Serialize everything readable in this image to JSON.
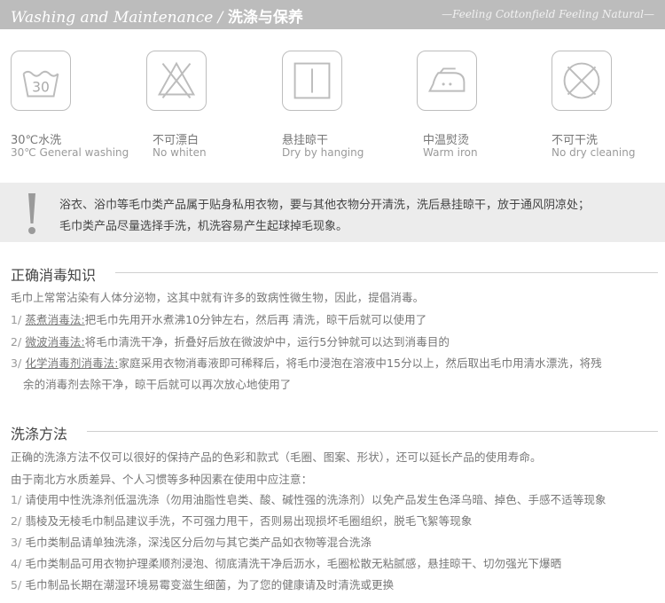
{
  "header": {
    "title_en": "Washing and Maintenance /",
    "title_cn": "洗涤与保养",
    "tagline": "—Feeling Cottonfield Feeling Natural—"
  },
  "care_icons": [
    {
      "icon": "wash-30-icon",
      "number": "30",
      "cn": "30℃水洗",
      "en": "30℃ General washing"
    },
    {
      "icon": "no-bleach-icon",
      "cn": "不可漂白",
      "en": "No whiten"
    },
    {
      "icon": "hang-dry-icon",
      "cn": "悬挂晾干",
      "en": "Dry by hanging"
    },
    {
      "icon": "warm-iron-icon",
      "cn": "中温熨烫",
      "en": "Warm iron"
    },
    {
      "icon": "no-dry-clean-icon",
      "cn": "不可干洗",
      "en": "No dry cleaning"
    }
  ],
  "notice": {
    "icon": "exclamation-icon",
    "line1": "浴衣、浴巾等毛巾类产品属于贴身私用衣物，要与其他衣物分开清洗，洗后悬挂晾干，放于通风阴凉处；",
    "line2": "毛巾类产品尽量选择手洗，机洗容易产生起球掉毛现象。"
  },
  "disinfection": {
    "title": "正确消毒知识",
    "intro": "毛巾上常常沾染有人体分泌物，这其中就有许多的致病性微生物，因此，提倡消毒。",
    "items": [
      {
        "num": "1/",
        "method": "蒸煮消毒法:",
        "text": "把毛巾先用开水煮沸10分钟左右，然后再 清洗，晾干后就可以使用了"
      },
      {
        "num": "2/",
        "method": "微波消毒法:",
        "text": "将毛巾清洗干净，折叠好后放在微波炉中，运行5分钟就可以达到消毒目的"
      },
      {
        "num": "3/",
        "method": "化学消毒剂消毒法:",
        "text": "家庭采用衣物消毒液即可稀释后，将毛巾浸泡在溶液中15分以上，然后取出毛巾用清水漂洗，将残",
        "text2": "余的消毒剂去除干净，晾干后就可以再次放心地使用了"
      }
    ]
  },
  "washing": {
    "title": "洗涤方法",
    "intro1": "正确的洗涤方法不仅可以很好的保持产品的色彩和款式（毛圈、图案、形状），还可以延长产品的使用寿命。",
    "intro2": "由于南北方水质差异、个人习惯等多种因素在使用中应注意：",
    "items": [
      {
        "num": "1/",
        "text": "请使用中性洗涤剂低温洗涤（勿用油脂性皂类、酸、碱性强的洗涤剂）以免产品发生色泽乌暗、掉色、手感不适等现象"
      },
      {
        "num": "2/",
        "text": "翡棱及无棱毛巾制品建议手洗，不可强力甩干，否则易出现损坏毛圈组织，脱毛飞絮等现象"
      },
      {
        "num": "3/",
        "text": "毛巾类制品请单独洗涤，深浅区分后勿与其它类产品如衣物等混合洗涤"
      },
      {
        "num": "4/",
        "text": "毛巾类制品可用衣物护理柔顺剂浸泡、彻底清洗干净后沥水，毛圈松散无粘腻感，悬挂晾干、切勿强光下爆晒"
      },
      {
        "num": "5/",
        "text": "毛巾制品长期在潮湿环境易霉变滋生细菌，为了您的健康请及时清洗或更换"
      }
    ]
  }
}
